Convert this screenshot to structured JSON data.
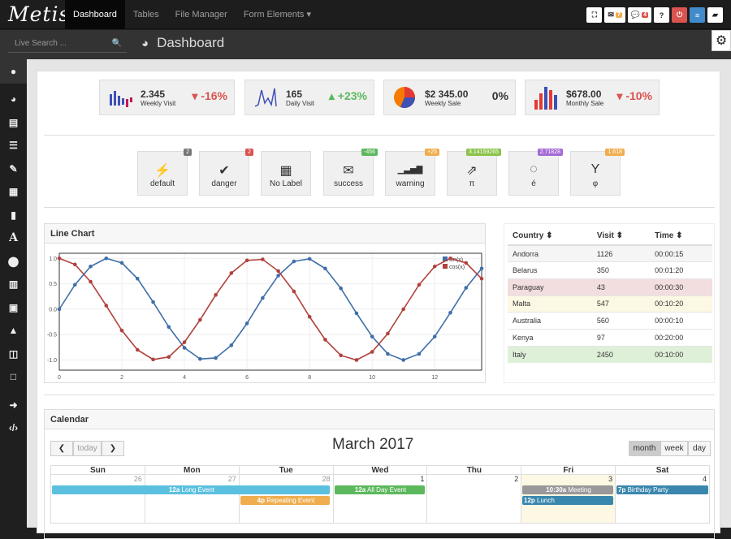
{
  "app": {
    "logo": "Metis"
  },
  "nav": {
    "items": [
      "Dashboard",
      "Tables",
      "File Manager",
      "Form Elements ▾"
    ]
  },
  "topright": {
    "mail_count": "7",
    "comments_count": "4",
    "help": "?"
  },
  "search": {
    "placeholder": "Live Search ..."
  },
  "page": {
    "title": "Dashboard"
  },
  "stats": [
    {
      "value": "2.345",
      "label": "Weekly Visit",
      "change": "-16%",
      "dir": "down"
    },
    {
      "value": "165",
      "label": "Daily Visit",
      "change": "+23%",
      "dir": "up"
    },
    {
      "value": "$2 345.00",
      "label": "Weekly Sale",
      "change": "0%",
      "dir": "none"
    },
    {
      "value": "$678.00",
      "label": "Monthly Sale",
      "change": "-10%",
      "dir": "down"
    }
  ],
  "quick": [
    {
      "glyph": "⚡",
      "label": "default",
      "badge": "2",
      "badge_color": "#777777"
    },
    {
      "glyph": "✔",
      "label": "danger",
      "badge": "2",
      "badge_color": "#d9534f"
    },
    {
      "glyph": "▦",
      "label": "No Label",
      "badge": "",
      "badge_color": ""
    },
    {
      "glyph": "✉",
      "label": "success",
      "badge": "-456",
      "badge_color": "#5cb85c"
    },
    {
      "glyph": "▁▃▅▇",
      "label": "warning",
      "badge": "+25",
      "badge_color": "#f0ad4e"
    },
    {
      "glyph": "⇗",
      "label": "π",
      "badge": "3.14159265",
      "badge_color": "#8bc34a"
    },
    {
      "glyph": "◌",
      "label": "é",
      "badge": "2.71828",
      "badge_color": "#a569d6"
    },
    {
      "glyph": "Y",
      "label": "φ",
      "badge": "1.618",
      "badge_color": "#f0ad4e"
    }
  ],
  "line_chart": {
    "title": "Line Chart"
  },
  "chart_data": {
    "type": "line",
    "xlim": [
      0,
      13.5
    ],
    "ylim": [
      -1.2,
      1.1
    ],
    "x_ticks": [
      "0",
      "2",
      "4",
      "6",
      "8",
      "10",
      "12"
    ],
    "y_ticks": [
      "1.0",
      "0.5",
      "0.0",
      "-0.5",
      "-1.0"
    ],
    "legend_position": "top-right",
    "series": [
      {
        "name": "sin(x)",
        "color": "#3f6fa8",
        "x": [
          0,
          0.5,
          1,
          1.5,
          2,
          2.5,
          3,
          3.5,
          4,
          4.5,
          5,
          5.5,
          6,
          6.5,
          7,
          7.5,
          8,
          8.5,
          9,
          9.5,
          10,
          10.5,
          11,
          11.5,
          12,
          12.5,
          13,
          13.5
        ],
        "y": [
          0,
          0.48,
          0.84,
          1.0,
          0.91,
          0.6,
          0.14,
          -0.35,
          -0.76,
          -0.98,
          -0.96,
          -0.71,
          -0.28,
          0.22,
          0.66,
          0.94,
          0.99,
          0.8,
          0.41,
          -0.08,
          -0.54,
          -0.88,
          -1.0,
          -0.88,
          -0.54,
          -0.07,
          0.42,
          0.8
        ]
      },
      {
        "name": "cos(x)",
        "color": "#b0413e",
        "x": [
          0,
          0.5,
          1,
          1.5,
          2,
          2.5,
          3,
          3.5,
          4,
          4.5,
          5,
          5.5,
          6,
          6.5,
          7,
          7.5,
          8,
          8.5,
          9,
          9.5,
          10,
          10.5,
          11,
          11.5,
          12,
          12.5,
          13,
          13.5
        ],
        "y": [
          1.0,
          0.88,
          0.54,
          0.07,
          -0.42,
          -0.8,
          -0.99,
          -0.94,
          -0.65,
          -0.21,
          0.28,
          0.71,
          0.96,
          0.98,
          0.75,
          0.35,
          -0.15,
          -0.6,
          -0.91,
          -1.0,
          -0.84,
          -0.48,
          0.0,
          0.48,
          0.84,
          1.0,
          0.91,
          0.6
        ]
      }
    ]
  },
  "table": {
    "headers": [
      "Country ⬍",
      "Visit ⬍",
      "Time ⬍"
    ],
    "rows": [
      {
        "country": "Andorra",
        "visit": "1126",
        "time": "00:00:15",
        "bg": "#f5f5f5"
      },
      {
        "country": "Belarus",
        "visit": "350",
        "time": "00:01:20",
        "bg": "#ffffff"
      },
      {
        "country": "Paraguay",
        "visit": "43",
        "time": "00:00:30",
        "bg": "#f2dede"
      },
      {
        "country": "Malta",
        "visit": "547",
        "time": "00:10:20",
        "bg": "#fcf8e3"
      },
      {
        "country": "Australia",
        "visit": "560",
        "time": "00:00:10",
        "bg": "#ffffff"
      },
      {
        "country": "Kenya",
        "visit": "97",
        "time": "00:20:00",
        "bg": "#ffffff"
      },
      {
        "country": "Italy",
        "visit": "2450",
        "time": "00:10:00",
        "bg": "#dff0d8"
      }
    ]
  },
  "calendar": {
    "title": "Calendar",
    "month": "March 2017",
    "today_label": "today",
    "views": [
      "month",
      "week",
      "day"
    ],
    "days": [
      "Sun",
      "Mon",
      "Tue",
      "Wed",
      "Thu",
      "Fri",
      "Sat"
    ],
    "dates": [
      "26",
      "27",
      "28",
      "1",
      "2",
      "3",
      "4"
    ],
    "events": [
      {
        "time": "12a",
        "title": "Long Event",
        "color": "#5bc0de"
      },
      {
        "time": "4p",
        "title": "Repeating Event",
        "color": "#f0ad4e"
      },
      {
        "time": "12a",
        "title": "All Day Event",
        "color": "#5cb85c"
      },
      {
        "time": "10:30a",
        "title": "Meeting",
        "color": "#999999"
      },
      {
        "time": "12p",
        "title": "Lunch",
        "color": "#3a87ad"
      },
      {
        "time": "7p",
        "title": "Birthday Party",
        "color": "#3a87ad"
      }
    ]
  }
}
